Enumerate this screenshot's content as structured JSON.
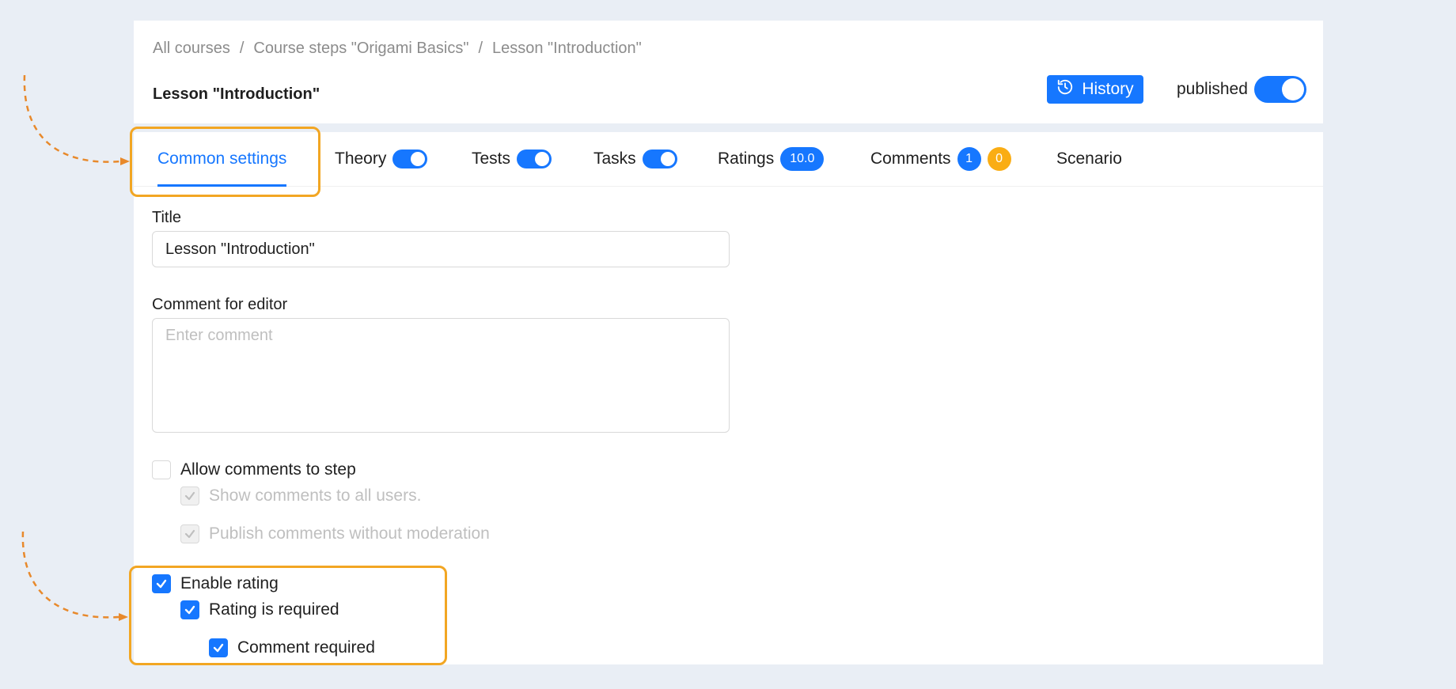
{
  "header": {
    "breadcrumb": [
      "All courses",
      "Course steps \"Origami Basics\"",
      "Lesson \"Introduction\""
    ],
    "breadcrumb_separator": "/",
    "page_title": "Lesson \"Introduction\"",
    "history_label": "History",
    "published_label": "published",
    "published_on": true
  },
  "tabs": {
    "common_settings": "Common settings",
    "theory": "Theory",
    "tests": "Tests",
    "tasks": "Tasks",
    "ratings": "Ratings",
    "ratings_badge": "10.0",
    "comments": "Comments",
    "comments_badge_blue": "1",
    "comments_badge_orange": "0",
    "scenario": "Scenario",
    "active": "common_settings"
  },
  "form": {
    "title_label": "Title",
    "title_value": "Lesson  \"Introduction\"",
    "comment_label": "Comment for editor",
    "comment_placeholder": "Enter comment",
    "allow_comments": "Allow comments to step",
    "show_comments": "Show comments to all users.",
    "publish_comments": "Publish comments without moderation",
    "enable_rating": "Enable rating",
    "rating_required": "Rating is required",
    "comment_required": "Comment required"
  },
  "checks": {
    "allow_comments": false,
    "show_comments": true,
    "publish_comments": true,
    "enable_rating": true,
    "rating_required": true,
    "comment_required": true
  },
  "colors": {
    "accent": "#1677ff",
    "highlight": "#f2a623",
    "arrow": "#e8892b",
    "badge_orange": "#faad14"
  },
  "icons": [
    "history-icon",
    "check-icon"
  ]
}
